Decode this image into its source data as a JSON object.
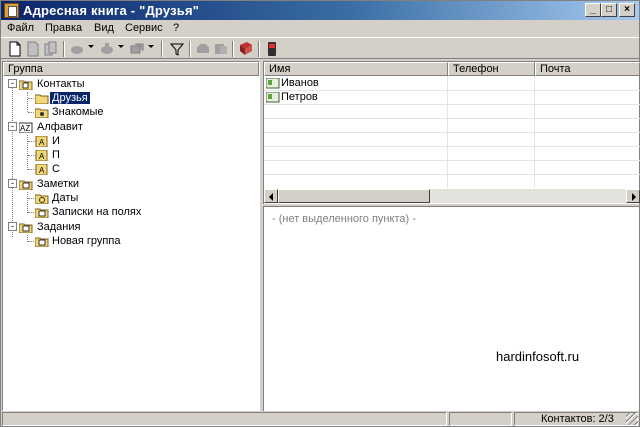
{
  "window": {
    "title": "Адресная книга - \"Друзья\"",
    "controls": {
      "minimize": "_",
      "maximize": "□",
      "close": "×"
    }
  },
  "menu": [
    "Файл",
    "Правка",
    "Вид",
    "Сервис",
    "?"
  ],
  "toolbar": {
    "icons": [
      "new-document-icon",
      "save-icon",
      "copy-icon",
      "prev-icon",
      "forward-icon",
      "group-icon",
      "filter-icon",
      "print-icon",
      "print-preview-icon",
      "address-book-icon",
      "phone-icon"
    ]
  },
  "tree": {
    "header": "Группа",
    "items": [
      {
        "label": "Контакты",
        "level": 0,
        "expander": "-"
      },
      {
        "label": "Друзья",
        "level": 1,
        "selected": true
      },
      {
        "label": "Знакомые",
        "level": 1
      },
      {
        "label": "Алфавит",
        "level": 0,
        "expander": "-"
      },
      {
        "label": "И",
        "level": 1
      },
      {
        "label": "П",
        "level": 1
      },
      {
        "label": "С",
        "level": 1
      },
      {
        "label": "Заметки",
        "level": 0,
        "expander": "-"
      },
      {
        "label": "Даты",
        "level": 1
      },
      {
        "label": "Записки на полях",
        "level": 1
      },
      {
        "label": "Задания",
        "level": 0,
        "expander": "-"
      },
      {
        "label": "Новая группа",
        "level": 1
      }
    ]
  },
  "contacts": {
    "columns": [
      "Имя",
      "Телефон",
      "Почта"
    ],
    "rows": [
      {
        "name": "Иванов",
        "phone": "",
        "email": ""
      },
      {
        "name": "Петров",
        "phone": "",
        "email": ""
      }
    ]
  },
  "detail": {
    "empty_text": "- (нет выделенного пункта) -"
  },
  "watermark": "hardinfosoft.ru",
  "status": {
    "count": "Контактов: 2/3"
  }
}
